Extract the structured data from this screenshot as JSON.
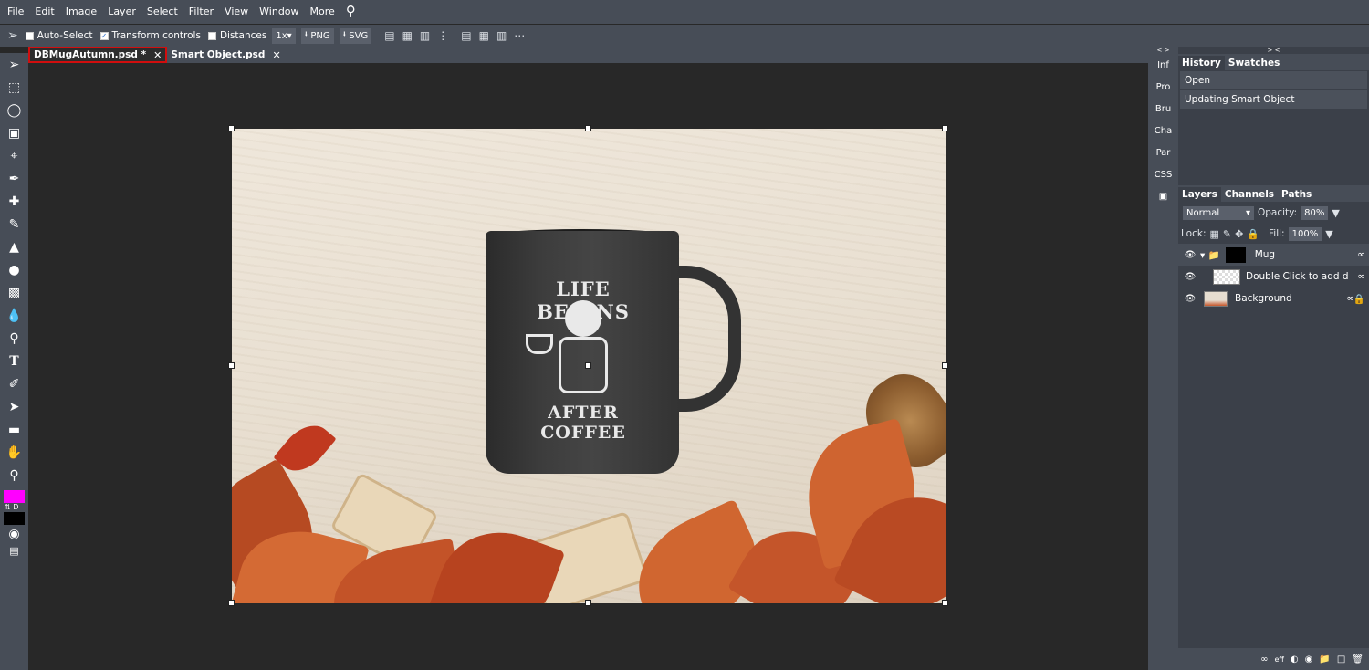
{
  "menu": {
    "items": [
      "File",
      "Edit",
      "Image",
      "Layer",
      "Select",
      "Filter",
      "View",
      "Window",
      "More"
    ]
  },
  "options": {
    "auto_select": "Auto-Select",
    "transform_controls": "Transform controls",
    "distances": "Distances",
    "scale": "1x",
    "png": "PNG",
    "svg": "SVG"
  },
  "tabs": [
    {
      "label": "DBMugAutumn.psd *"
    },
    {
      "label": "Smart Object.psd"
    }
  ],
  "mug": {
    "line1": "LIFE BEGINS",
    "line2": "AFTER COFFEE"
  },
  "strip": [
    "Inf",
    "Pro",
    "Bru",
    "Cha",
    "Par",
    "CSS"
  ],
  "history": {
    "tab1": "History",
    "tab2": "Swatches",
    "items": [
      "Open",
      "Updating Smart Object"
    ]
  },
  "layers": {
    "tab1": "Layers",
    "tab2": "Channels",
    "tab3": "Paths",
    "blend": "Normal",
    "opacity_label": "Opacity:",
    "opacity": "80%",
    "lock_label": "Lock:",
    "fill_label": "Fill:",
    "fill": "100%",
    "rows": [
      "Mug",
      "Double Click to add d",
      "Background"
    ]
  },
  "colors": {
    "fg": "#ff00ff",
    "bg": "#000000",
    "accent": "#d10e0e"
  }
}
